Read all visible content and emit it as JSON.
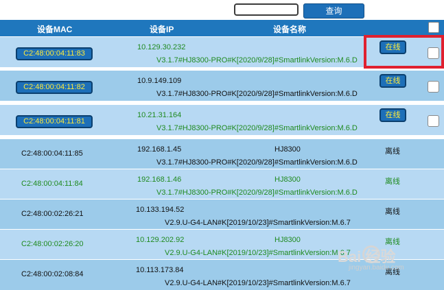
{
  "toolbar": {
    "search_value": "",
    "search_label": "查询"
  },
  "header": {
    "col_mac": "设备MAC",
    "col_ip": "设备IP",
    "col_name": "设备名称"
  },
  "rows": [
    {
      "mac": "C2:48:00:04:11:83",
      "ip": "10.129.30.232",
      "name": "",
      "version": "V3.1.7#HJ8300-PRO#K[2020/9/28]#SmartlinkVersion:M.6.D",
      "status": "在线"
    },
    {
      "mac": "C2:48:00:04:11:82",
      "ip": "10.9.149.109",
      "name": "",
      "version": "V3.1.7#HJ8300-PRO#K[2020/9/28]#SmartlinkVersion:M.6.D",
      "status": "在线"
    },
    {
      "mac": "C2:48:00:04:11:81",
      "ip": "10.21.31.164",
      "name": "",
      "version": "V3.1.7#HJ8300-PRO#K[2020/9/28]#SmartlinkVersion:M.6.D",
      "status": "在线"
    },
    {
      "mac": "C2:48:00:04:11:85",
      "ip": "192.168.1.45",
      "name": "HJ8300",
      "version": "V3.1.7#HJ8300-PRO#K[2020/9/28]#SmartlinkVersion:M.6.D",
      "status": "离线"
    },
    {
      "mac": "C2:48:00:04:11:84",
      "ip": "192.168.1.46",
      "name": "HJ8300",
      "version": "V3.1.7#HJ8300-PRO#K[2020/9/28]#SmartlinkVersion:M.6.D",
      "status": "离线"
    },
    {
      "mac": "C2:48:00:02:26:21",
      "ip": "10.133.194.52",
      "name": "",
      "version": "V2.9.U-G4-LAN#K[2019/10/23]#SmartlinkVersion:M.6.7",
      "status": "离线"
    },
    {
      "mac": "C2:48:00:02:26:20",
      "ip": "10.129.202.92",
      "name": "HJ8300",
      "version": "V2.9.U-G4-LAN#K[2019/10/23]#SmartlinkVersion:M.6.7",
      "status": "离线"
    },
    {
      "mac": "C2:48:00:02:08:84",
      "ip": "10.113.173.84",
      "name": "",
      "version": "V2.9.U-G4-LAN#K[2019/10/23]#SmartlinkVersion:M.6.7",
      "status": "离线"
    }
  ],
  "watermark": {
    "brand": "Bai 经验",
    "url": "jingyan.baidu.com"
  }
}
